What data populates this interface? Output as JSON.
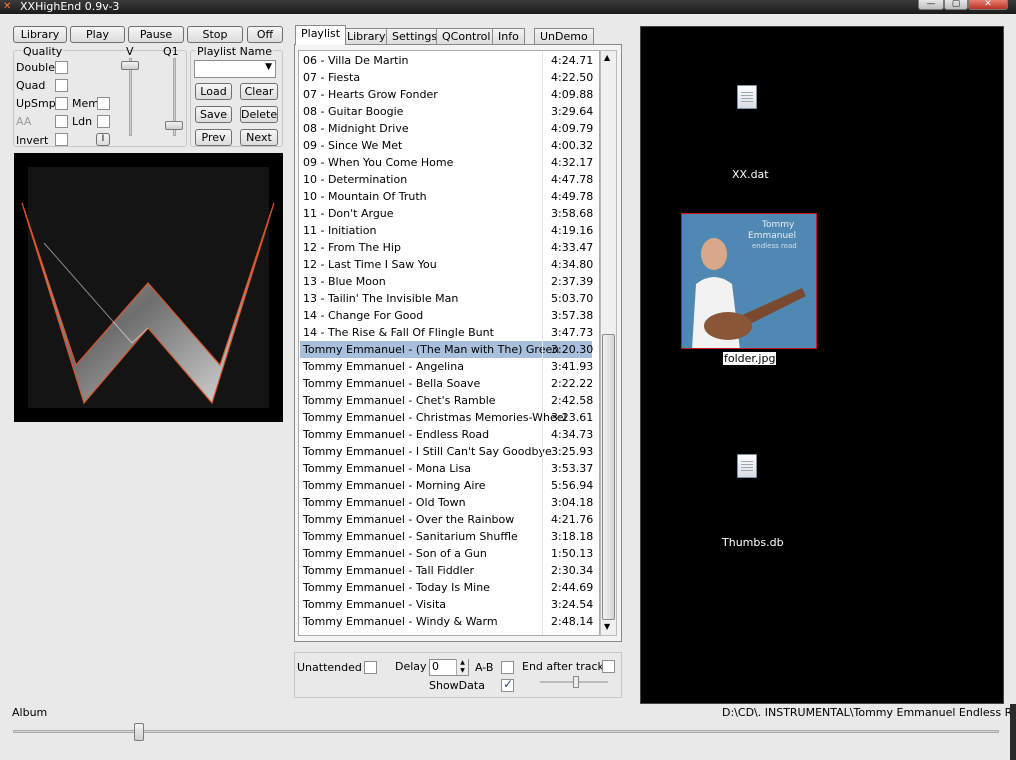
{
  "window": {
    "title": "XXHighEnd 0.9v-3",
    "min": "—",
    "max": "▢",
    "close": "✕"
  },
  "transport": {
    "library": "Library",
    "play": "Play",
    "pause": "Pause",
    "stop": "Stop",
    "off": "Off"
  },
  "quality": {
    "heading": "Quality",
    "v_label": "V",
    "q1_label": "Q1",
    "double": "Double",
    "quad": "Quad",
    "upsmp": "UpSmp",
    "mem": "Mem",
    "aa": "AA",
    "ldn": "Ldn",
    "invert": "Invert",
    "info_btn": "I"
  },
  "playlist_name": {
    "label": "Playlist Name",
    "value": "",
    "load": "Load",
    "clear": "Clear",
    "save": "Save",
    "delete": "Delete",
    "prev": "Prev",
    "next": "Next"
  },
  "tabs": [
    "Playlist",
    "Library",
    "Settings",
    "QControl",
    "Info",
    "UnDemo"
  ],
  "active_tab": "Playlist",
  "playlist": [
    {
      "title": "06 - Villa De Martin",
      "duration": "4:24.71"
    },
    {
      "title": "07 - Fiesta",
      "duration": "4:22.50"
    },
    {
      "title": "07 - Hearts Grow Fonder",
      "duration": "4:09.88"
    },
    {
      "title": "08 - Guitar Boogie",
      "duration": "3:29.64"
    },
    {
      "title": "08 - Midnight Drive",
      "duration": "4:09.79"
    },
    {
      "title": "09 - Since We Met",
      "duration": "4:00.32"
    },
    {
      "title": "09 - When You Come Home",
      "duration": "4:32.17"
    },
    {
      "title": "10 - Determination",
      "duration": "4:47.78"
    },
    {
      "title": "10 - Mountain Of Truth",
      "duration": "4:49.78"
    },
    {
      "title": "11 - Don't Argue",
      "duration": "3:58.68"
    },
    {
      "title": "11 - Initiation",
      "duration": "4:19.16"
    },
    {
      "title": "12 - From The Hip",
      "duration": "4:33.47"
    },
    {
      "title": "12 - Last Time I Saw You",
      "duration": "4:34.80"
    },
    {
      "title": "13 - Blue Moon",
      "duration": "2:37.39"
    },
    {
      "title": "13 - Tailin' The Invisible Man",
      "duration": "5:03.70"
    },
    {
      "title": "14 - Change For Good",
      "duration": "3:57.38"
    },
    {
      "title": "14 - The Rise & Fall Of Flingle Bunt",
      "duration": "3:47.73"
    },
    {
      "title": "Tommy Emmanuel - (The Man with The) Green",
      "duration": "3:20.30",
      "selected": true
    },
    {
      "title": "Tommy Emmanuel - Angelina",
      "duration": "3:41.93"
    },
    {
      "title": "Tommy Emmanuel - Bella Soave",
      "duration": "2:22.22"
    },
    {
      "title": "Tommy Emmanuel - Chet's Ramble",
      "duration": "2:42.58"
    },
    {
      "title": "Tommy Emmanuel - Christmas Memories-Wheel",
      "duration": "3:23.61"
    },
    {
      "title": "Tommy Emmanuel - Endless Road",
      "duration": "4:34.73"
    },
    {
      "title": "Tommy Emmanuel - I Still Can't Say Goodbye",
      "duration": "3:25.93"
    },
    {
      "title": "Tommy Emmanuel - Mona Lisa",
      "duration": "3:53.37"
    },
    {
      "title": "Tommy Emmanuel - Morning Aire",
      "duration": "5:56.94"
    },
    {
      "title": "Tommy Emmanuel - Old Town",
      "duration": "3:04.18"
    },
    {
      "title": "Tommy Emmanuel - Over the Rainbow",
      "duration": "4:21.76"
    },
    {
      "title": "Tommy Emmanuel - Sanitarium Shuffle",
      "duration": "3:18.18"
    },
    {
      "title": "Tommy Emmanuel - Son of a Gun",
      "duration": "1:50.13"
    },
    {
      "title": "Tommy Emmanuel - Tall Fiddler",
      "duration": "2:30.34"
    },
    {
      "title": "Tommy Emmanuel - Today Is Mine",
      "duration": "2:44.69"
    },
    {
      "title": "Tommy Emmanuel - Visita",
      "duration": "3:24.54"
    },
    {
      "title": "Tommy Emmanuel - Windy & Warm",
      "duration": "2:48.14"
    }
  ],
  "options": {
    "unattended": "Unattended",
    "delay": "Delay",
    "delay_value": "0",
    "ab": "A-B",
    "end_after_track": "End after track",
    "showdata": "ShowData",
    "showdata_checked": true
  },
  "files": [
    {
      "name": "XX.dat",
      "icon": "document-icon"
    },
    {
      "name": "folder.jpg",
      "icon": "album-thumbnail"
    },
    {
      "name": "Thumbs.db",
      "icon": "database-icon"
    }
  ],
  "thumb_text": {
    "line1": "Tommy",
    "line2": "Emmanuel",
    "line3": "endless road"
  },
  "status": {
    "album_label": "Album",
    "path": "D:\\CD\\. INSTRUMENTAL\\Tommy Emmanuel Endless Road"
  }
}
